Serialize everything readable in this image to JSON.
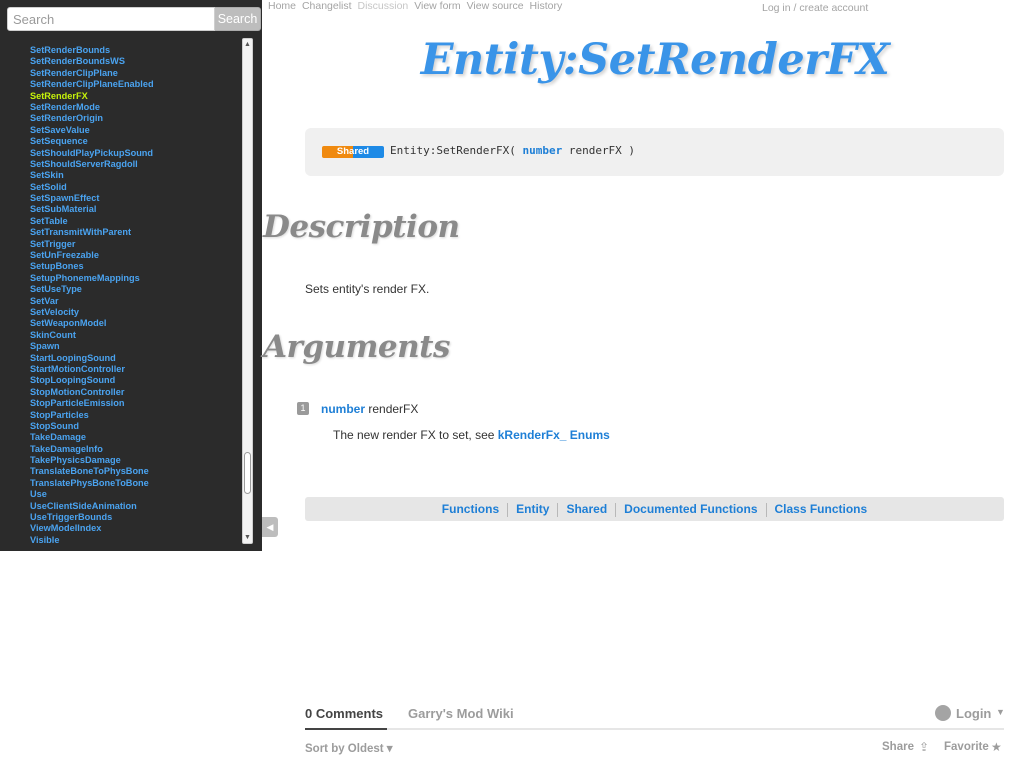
{
  "search": {
    "placeholder": "Search",
    "button_label": "Search"
  },
  "sidebar": {
    "items": [
      "SetRenderBounds",
      "SetRenderBoundsWS",
      "SetRenderClipPlane",
      "SetRenderClipPlaneEnabled",
      "SetRenderFX",
      "SetRenderMode",
      "SetRenderOrigin",
      "SetSaveValue",
      "SetSequence",
      "SetShouldPlayPickupSound",
      "SetShouldServerRagdoll",
      "SetSkin",
      "SetSolid",
      "SetSpawnEffect",
      "SetSubMaterial",
      "SetTable",
      "SetTransmitWithParent",
      "SetTrigger",
      "SetUnFreezable",
      "SetupBones",
      "SetupPhonemeMappings",
      "SetUseType",
      "SetVar",
      "SetVelocity",
      "SetWeaponModel",
      "SkinCount",
      "Spawn",
      "StartLoopingSound",
      "StartMotionController",
      "StopLoopingSound",
      "StopMotionController",
      "StopParticleEmission",
      "StopParticles",
      "StopSound",
      "TakeDamage",
      "TakeDamageInfo",
      "TakePhysicsDamage",
      "TranslateBoneToPhysBone",
      "TranslatePhysBoneToBone",
      "Use",
      "UseClientSideAnimation",
      "UseTriggerBounds",
      "ViewModelIndex",
      "Visible"
    ],
    "active_item": "SetRenderFX",
    "scroll_up_icon": "▲",
    "scroll_down_icon": "▼",
    "collapse_icon": "◀"
  },
  "nav": {
    "home": "Home",
    "changelist": "Changelist",
    "discussion": "Discussion",
    "view_form": "View form",
    "view_source": "View source",
    "history": "History",
    "login": "Log in / create account"
  },
  "page": {
    "title": "Entity:SetRenderFX",
    "realm": "Shared",
    "signature_prefix": "Entity:SetRenderFX( ",
    "signature_type": "number",
    "signature_suffix": " renderFX )",
    "description_heading": "Description",
    "description": "Sets entity's render FX.",
    "arguments_heading": "Arguments",
    "argument": {
      "index": "1",
      "type": "number",
      "name": "renderFX",
      "description_prefix": "The new render FX to set, see ",
      "link": "kRenderFx_ Enums"
    },
    "categories": [
      "Functions",
      "Entity",
      "Shared",
      "Documented Functions",
      "Class Functions"
    ]
  },
  "comments": {
    "count_label": "0 Comments",
    "forum_name": "Garry's Mod Wiki",
    "login_label": "Login",
    "sort_label": "Sort by Oldest",
    "share_label": "Share",
    "favorite_label": "Favorite"
  },
  "colors": {
    "link_blue": "#3a94e8",
    "active_item": "#c6f20a",
    "sidebar_bg": "#2b2b2b",
    "realm_shared_orange": "#f08a10",
    "realm_shared_blue": "#1e8ae6"
  }
}
